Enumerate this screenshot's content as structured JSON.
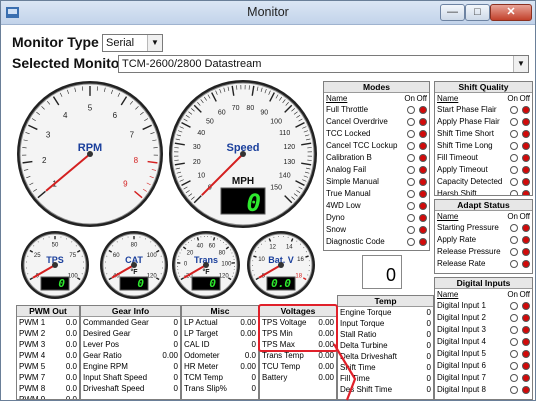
{
  "window": {
    "title": "Monitor",
    "min_glyph": "—",
    "max_glyph": "□",
    "close_glyph": "✕"
  },
  "monitor_type": {
    "label": "Monitor Type",
    "value": "Serial"
  },
  "selected_monitor": {
    "label": "Selected Monitor",
    "value": "TCM-2600/2800 Datastream"
  },
  "gauges": {
    "rpm": {
      "label": "RPM",
      "ticks": [
        "1",
        "2",
        "3",
        "4",
        "5",
        "6",
        "7",
        "8",
        "9"
      ],
      "needle_value": 0
    },
    "speed": {
      "label": "Speed",
      "unit": "MPH",
      "ticks": [
        "0",
        "10",
        "20",
        "30",
        "40",
        "50",
        "60",
        "70",
        "80",
        "90",
        "100",
        "110",
        "120",
        "130",
        "140",
        "150"
      ],
      "digital": "0",
      "needle_value": 0
    },
    "tps": {
      "label": "TPS",
      "ticks": [
        "0",
        "25",
        "50",
        "75",
        "100"
      ],
      "digital": "0"
    },
    "cat": {
      "label": "CAT",
      "unit": "°F",
      "ticks": [
        "40",
        "60",
        "80",
        "100",
        "120"
      ],
      "digital": "0"
    },
    "trans": {
      "label": "Trans",
      "unit": "°F",
      "ticks": [
        "-20",
        "0",
        "20",
        "40",
        "60",
        "80",
        "100",
        "120"
      ],
      "digital": "0"
    },
    "batv": {
      "label": "Bat. V",
      "ticks": [
        "8",
        "10",
        "12",
        "14",
        "16",
        "18"
      ],
      "digital": "0.0"
    }
  },
  "counter": {
    "value": "0"
  },
  "modes": {
    "title": "Modes",
    "col_name": "Name",
    "col_on": "On",
    "col_off": "Off",
    "items": [
      "Full Throttle",
      "Cancel Overdrive",
      "TCC Locked",
      "Cancel TCC Lockup",
      "Calibration B",
      "Analog Fail",
      "Simple Manual",
      "True Manual",
      "4WD Low",
      "Dyno",
      "Snow",
      "Diagnostic Code"
    ]
  },
  "shift_quality": {
    "title": "Shift Quality",
    "col_name": "Name",
    "col_on": "On",
    "col_off": "Off",
    "items": [
      "Start Phase Flair",
      "Apply Phase Flair",
      "Shift Time Short",
      "Shift Time Long",
      "Fill Timeout",
      "Apply Timeout",
      "Capacity Detected",
      "Harsh Shift"
    ]
  },
  "adapt_status": {
    "title": "Adapt Status",
    "col_name": "Name",
    "col_on": "On",
    "col_off": "Off",
    "items": [
      "Starting Pressure",
      "Apply Rate",
      "Release Pressure",
      "Release Rate"
    ]
  },
  "digital_inputs": {
    "title": "Digital Inputs",
    "col_name": "Name",
    "col_on": "On",
    "col_off": "Off",
    "items": [
      "Digital Input 1",
      "Digital Input 2",
      "Digital Input 3",
      "Digital Input 4",
      "Digital Input 5",
      "Digital Input 6",
      "Digital Input 7",
      "Digital Input 8"
    ]
  },
  "pwm_out": {
    "title": "PWM Out",
    "rows": [
      [
        "PWM 1",
        "0.0"
      ],
      [
        "PWM 2",
        "0.0"
      ],
      [
        "PWM 3",
        "0.0"
      ],
      [
        "PWM 4",
        "0.0"
      ],
      [
        "PWM 5",
        "0.0"
      ],
      [
        "PWM 7",
        "0.0"
      ],
      [
        "PWM 8",
        "0.0"
      ],
      [
        "PWM 9",
        "0.0"
      ]
    ]
  },
  "gear_info": {
    "title": "Gear Info",
    "rows": [
      [
        "Commanded Gear",
        "0"
      ],
      [
        "Desired Gear",
        "0"
      ],
      [
        "Lever Pos",
        "0"
      ],
      [
        "Gear Ratio",
        "0.00"
      ],
      [
        "Engine RPM",
        "0"
      ],
      [
        "Input Shaft Speed",
        "0"
      ],
      [
        "Driveshaft Speed",
        "0"
      ]
    ]
  },
  "misc": {
    "title": "Misc",
    "rows": [
      [
        "LP Actual",
        "0.00"
      ],
      [
        "LP Target",
        "0.00"
      ],
      [
        "CAL ID",
        "0"
      ],
      [
        "Odometer",
        "0.0"
      ],
      [
        "HR Meter",
        "0.00"
      ],
      [
        "TCM Temp",
        "0"
      ],
      [
        "Trans Slip%",
        "0"
      ]
    ]
  },
  "voltages": {
    "title": "Voltages",
    "rows": [
      [
        "TPS Voltage",
        "0.00"
      ],
      [
        "TPS Min",
        "0.00"
      ],
      [
        "TPS Max",
        "0.00"
      ],
      [
        "Trans Temp",
        "0.00"
      ],
      [
        "TCU Temp",
        "0.00"
      ],
      [
        "Battery",
        "0.00"
      ]
    ]
  },
  "temp": {
    "title": "Temp",
    "rows": [
      [
        "Engine Torque",
        "0"
      ],
      [
        "Input Torque",
        "0"
      ],
      [
        "Stall Ratio",
        "0"
      ],
      [
        "Delta Turbine",
        "0"
      ],
      [
        "Delta Driveshaft",
        "0"
      ],
      [
        "Shift Time",
        "0"
      ],
      [
        "Fill Time",
        "0"
      ],
      [
        "Des Shift Time",
        "0"
      ]
    ]
  },
  "colors": {
    "needle": "#d42020",
    "redline": "#d42020",
    "lcd_bg": "#000",
    "lcd_fg": "#2ee82e",
    "gauge_label": "#1a3f9c",
    "highlight": "#e0202a"
  }
}
